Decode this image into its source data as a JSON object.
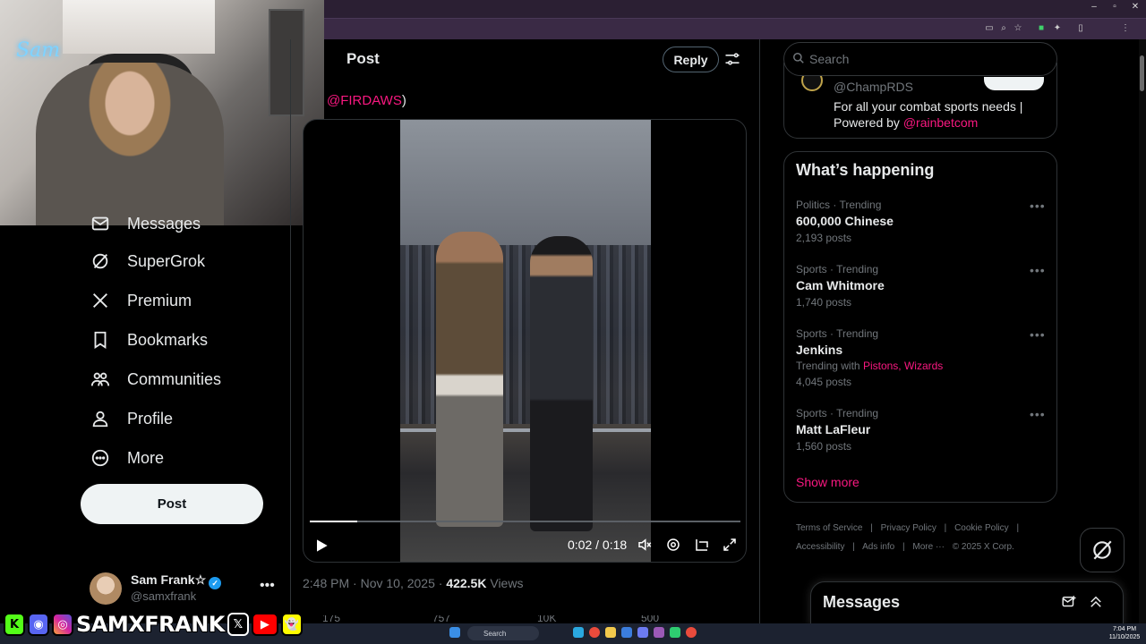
{
  "browser": {
    "window_controls": [
      "–",
      "▫",
      "✕"
    ]
  },
  "nav": {
    "items": [
      {
        "label": "Messages",
        "icon": "envelope-icon"
      },
      {
        "label": "SuperGrok",
        "icon": "grok-icon"
      },
      {
        "label": "Premium",
        "icon": "x-logo-icon"
      },
      {
        "label": "Bookmarks",
        "icon": "bookmark-icon"
      },
      {
        "label": "Communities",
        "icon": "people-icon"
      },
      {
        "label": "Profile",
        "icon": "person-icon"
      },
      {
        "label": "More",
        "icon": "more-circle-icon"
      }
    ],
    "post_button": "Post",
    "account": {
      "name": "Sam Frank☆",
      "handle": "@samxfrank",
      "more": "•••"
    }
  },
  "post": {
    "header_title": "Post",
    "reply_label": "Reply",
    "mention_text": "@FIRDAWS",
    "mention_suffix": ")",
    "video": {
      "time": "0:02 / 0:18",
      "progress_fraction": 0.11
    },
    "meta": {
      "timestamp": "2:48 PM · Nov 10, 2025 · ",
      "views_count": "422.5K",
      "views_label": " Views"
    },
    "actions": [
      "175",
      "757",
      "10K",
      "500"
    ]
  },
  "sidebar": {
    "search_placeholder": "Search",
    "promo": {
      "handle": "@ChampRDS",
      "bio": "For all your combat sports needs | Powered by ",
      "bio_mention": "@rainbetcom"
    },
    "happening_title": "What’s happening",
    "trends": [
      {
        "context": "Politics · Trending",
        "name": "600,000 Chinese",
        "count": "2,193 posts"
      },
      {
        "context": "Sports · Trending",
        "name": "Cam Whitmore",
        "count": "1,740 posts"
      },
      {
        "context": "Sports · Trending",
        "name": "Jenkins",
        "with_prefix": "Trending with",
        "with_links": "Pistons, Wizards",
        "count": "4,045 posts"
      },
      {
        "context": "Sports · Trending",
        "name": "Matt LaFleur",
        "count": "1,560 posts"
      }
    ],
    "show_more": "Show more",
    "footer": {
      "line1": [
        "Terms of Service",
        "|",
        "Privacy Policy",
        "|",
        "Cookie Policy",
        "|"
      ],
      "line2": [
        "Accessibility",
        "|",
        "Ads info",
        "|",
        "More ···",
        "© 2025 X Corp."
      ]
    },
    "messages_title": "Messages"
  },
  "overlay": {
    "streamer_name": "SAMXFRANK",
    "social_icons": [
      "K",
      "◉",
      "◎",
      "𝕏",
      "▶",
      "👻"
    ],
    "neon_sign": "Sam"
  },
  "taskbar": {
    "search_label": "Search",
    "clock_time": "7:04 PM",
    "clock_date": "11/10/2025"
  },
  "colors": {
    "accent": "#f91880",
    "verified": "#1d9bf0",
    "background": "#000000",
    "text": "#e7e9ea",
    "muted": "#71767b"
  }
}
